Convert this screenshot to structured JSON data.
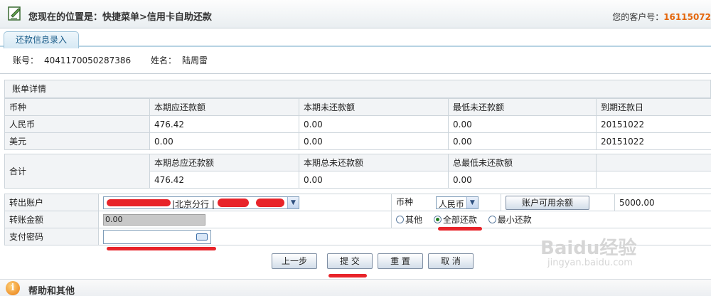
{
  "header": {
    "location": "您现在的位置是：快捷菜单>信用卡自助还款",
    "customer_label": "您的客户号：",
    "customer_number": "16115072"
  },
  "tab": {
    "label": "还款信息录入"
  },
  "account": {
    "account_label": "账号：",
    "account_number": "4041170050287386",
    "name_label": "姓名：",
    "name": "陆周雷"
  },
  "bill": {
    "section_title": "账单详情",
    "headers": [
      "币种",
      "本期应还款额",
      "本期未还款额",
      "最低未还款额",
      "到期还款日"
    ],
    "rows": [
      [
        "人民币",
        "476.42",
        "0.00",
        "0.00",
        "20151022"
      ],
      [
        "美元",
        "0.00",
        "0.00",
        "0.00",
        "20151022"
      ]
    ],
    "total": {
      "label": "合计",
      "headers": [
        "本期总应还款额",
        "本期总未还款额",
        "总最低未还款额"
      ],
      "values": [
        "476.42",
        "0.00",
        "0.00"
      ]
    }
  },
  "form": {
    "transfer_account_label": "转出账户",
    "transfer_account_value": "|北京分行 |",
    "currency_label": "币种",
    "currency_value": "人民币",
    "available_button": "账户可用余额",
    "available_amount": "5000.00",
    "amount_label": "转账金额",
    "amount_value": "0.00",
    "repay_options": [
      "其他",
      "全部还款",
      "最小还款"
    ],
    "repay_selected": "全部还款",
    "password_label": "支付密码"
  },
  "buttons": {
    "prev": "上一步",
    "submit": "提 交",
    "reset": "重 置",
    "cancel": "取 消"
  },
  "help": {
    "title": "帮助和其他"
  },
  "watermark": {
    "brand": "Baidu经验",
    "url": "jingyan.baidu.com"
  },
  "colors": {
    "accent": "#e4660c",
    "tab_text": "#1b5d8a",
    "annotation": "#e8242a",
    "selected_radio": "#1e7d22"
  }
}
